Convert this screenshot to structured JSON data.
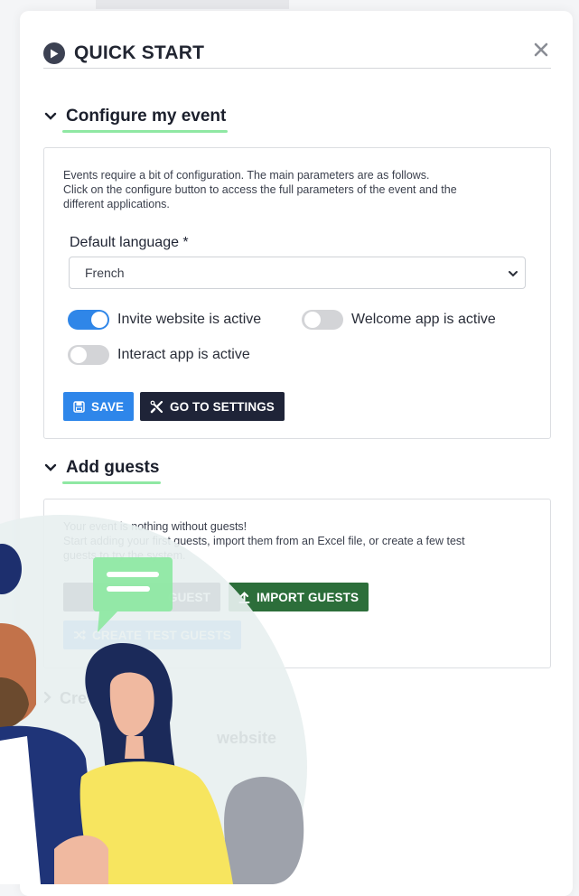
{
  "header": {
    "title": "QUICK START"
  },
  "configure": {
    "title": "Configure my event",
    "description": [
      "Events require a bit of configuration. The main parameters are as follows.",
      "Click on the configure button to access the full parameters of the event and the",
      "different applications."
    ],
    "language_label": "Default language *",
    "language_value": "French",
    "toggles": [
      {
        "label": "Invite website is active",
        "state": "on"
      },
      {
        "label": "Welcome app is active",
        "state": "off"
      },
      {
        "label": "Interact app is active",
        "state": "off"
      }
    ],
    "save_label": "SAVE",
    "settings_label": "GO TO SETTINGS"
  },
  "guests": {
    "title": "Add guests",
    "description": [
      "Your event is nothing without guests!",
      "Start adding your first guests, import them from an Excel file, or create a few test",
      "guests to try the system."
    ],
    "add_label": "GUEST",
    "import_label": "IMPORT GUESTS",
    "test_label": "CREATE TEST GUESTS"
  },
  "partial": {
    "section_prefix": "Cre",
    "website_text": "website"
  },
  "colors": {
    "accent_blue": "#2e86ea",
    "dark_navy": "#1f2438",
    "import_green": "#2c6e3a",
    "underline_green": "#8fe8a3"
  }
}
